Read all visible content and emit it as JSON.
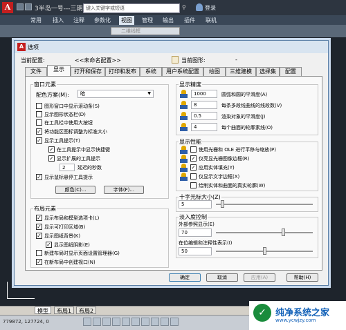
{
  "app": {
    "title": "3半岛一号---三期...",
    "search_placeholder": "键入关键字或短语",
    "login": "登录",
    "menus": [
      "常用",
      "插入",
      "注释",
      "参数化",
      "视图",
      "管理",
      "输出",
      "插件",
      "联机"
    ],
    "layer_combo": "二维线框",
    "bottom_tabs": [
      "模型",
      "布局1",
      "布局2"
    ],
    "coords": "779872, 127724, 0"
  },
  "watermark": {
    "brand": "纯净系统之家",
    "url": "www.ycwjzy.com",
    "logo_color": "#1a8c3c",
    "text_color": "#1261b8"
  },
  "dialog": {
    "title": "选项",
    "current_profile_label": "当前配置:",
    "current_profile_value": "<<未命名配置>>",
    "current_drawing_label": "当前图形:",
    "current_drawing_value": "-",
    "tabs": [
      "文件",
      "显示",
      "打开和保存",
      "打印和发布",
      "系统",
      "用户系统配置",
      "绘图",
      "三维建模",
      "选择集",
      "配置"
    ],
    "active_tab": "显示",
    "window_elements": {
      "title": "窗口元素",
      "color_scheme_label": "配色方案(M):",
      "color_scheme_value": "暗",
      "checks": [
        {
          "label": "图形窗口中显示滚动条(S)",
          "checked": false
        },
        {
          "label": "显示图形状态栏(D)",
          "checked": false
        },
        {
          "label": "在工具栏中使用大按钮",
          "checked": false
        },
        {
          "label": "将功能区图标调整为标准大小",
          "checked": true
        },
        {
          "label": "显示工具提示(T)",
          "checked": true
        },
        {
          "label": "在工具提示中显示快捷键",
          "checked": true
        },
        {
          "label": "显示扩展的工具提示",
          "checked": true
        },
        {
          "label": "显示鼠标悬停工具提示",
          "checked": true
        }
      ],
      "delay_value": "2",
      "delay_label": "延迟的秒数",
      "colors_button": "颜色(C)...",
      "fonts_button": "字体(F)..."
    },
    "layout_elements": {
      "title": "布局元素",
      "checks": [
        {
          "label": "显示布局和模型选项卡(L)",
          "checked": true
        },
        {
          "label": "显示可打印区域(B)",
          "checked": true
        },
        {
          "label": "显示图纸背景(K)",
          "checked": true
        },
        {
          "label": "显示图纸阴影(E)",
          "checked": true
        },
        {
          "label": "新建布局时显示页面设置管理器(G)",
          "checked": false
        },
        {
          "label": "在新布局中创建视口(N)",
          "checked": true
        }
      ]
    },
    "display_resolution": {
      "title": "显示精度",
      "items": [
        {
          "value": "1000",
          "label": "圆弧和圆的平滑度(A)"
        },
        {
          "value": "8",
          "label": "每条多段线曲线的线段数(V)"
        },
        {
          "value": "0.5",
          "label": "渲染对象的平滑度(J)"
        },
        {
          "value": "4",
          "label": "每个曲面的轮廓素线(O)"
        }
      ]
    },
    "display_performance": {
      "title": "显示性能",
      "checks": [
        {
          "label": "使用光栅和 OLE 进行平移与缩放(P)",
          "checked": false
        },
        {
          "label": "仅亮显光栅图像边框(R)",
          "checked": true
        },
        {
          "label": "应用实体填充(Y)",
          "checked": true
        },
        {
          "label": "仅显示文字边框(X)",
          "checked": false
        },
        {
          "label": "绘制实体和曲面的真实轮廓(W)",
          "checked": false
        }
      ]
    },
    "crosshair": {
      "title": "十字光标大小(Z)",
      "value": "5",
      "slider_fraction": 0.05
    },
    "fade_control": {
      "title": "淡入度控制",
      "xref_label": "外部参照显示(E)",
      "xref_value": "70",
      "xref_fraction": 0.7,
      "inplace_label": "在位编辑和注释性表示(I)",
      "inplace_value": "50",
      "inplace_fraction": 0.5
    },
    "buttons": {
      "ok": "确定",
      "cancel": "取消",
      "apply": "应用(A)",
      "help": "帮助(H)"
    }
  }
}
